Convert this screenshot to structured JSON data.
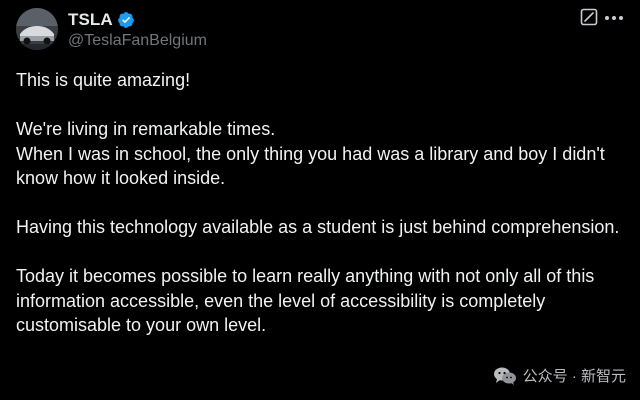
{
  "author": {
    "display_name": "TSLA",
    "handle": "@TeslaFanBelgium",
    "verified": true
  },
  "header_icons": {
    "grok": "grok-icon",
    "more": "more-options-icon"
  },
  "tweet": {
    "line1": "This is quite amazing!",
    "line2": "We're living in remarkable times.",
    "line3": "When I was in school, the only thing you had was a library and boy I didn't know how it looked inside.",
    "line4": "Having this technology available as a student is just behind comprehension.",
    "line5": "Today it becomes possible to learn really anything with not only all of this information accessible, even the level of accessibility is completely customisable to your own level."
  },
  "watermark": {
    "text": "公众号 · 新智元",
    "icon": "wechat-icon"
  },
  "colors": {
    "background": "#000000",
    "text": "#e7e9ea",
    "muted": "#71767b",
    "verified": "#1d9bf0"
  }
}
